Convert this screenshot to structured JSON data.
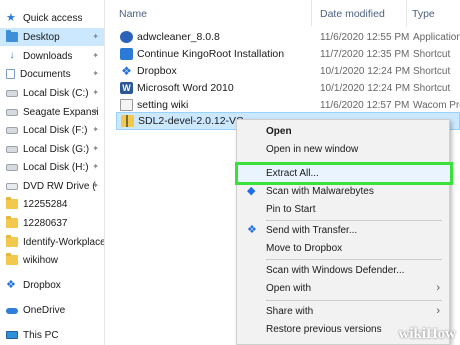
{
  "nav": {
    "items": [
      {
        "label": "Quick access",
        "icon": "star-icon"
      },
      {
        "label": "Desktop",
        "icon": "folder-icon",
        "pinned": true,
        "selected": true
      },
      {
        "label": "Downloads",
        "icon": "download-icon",
        "pinned": true
      },
      {
        "label": "Documents",
        "icon": "documents-icon",
        "pinned": true
      },
      {
        "label": "Local Disk (C:)",
        "icon": "drive-icon",
        "pinned": true
      },
      {
        "label": "Seagate Expansi",
        "icon": "drive-icon",
        "pinned": true
      },
      {
        "label": "Local Disk (F:)",
        "icon": "drive-icon",
        "pinned": true
      },
      {
        "label": "Local Disk (G:)",
        "icon": "drive-icon",
        "pinned": true
      },
      {
        "label": "Local Disk (H:)",
        "icon": "drive-icon",
        "pinned": true
      },
      {
        "label": "DVD RW Drive (",
        "icon": "dvd-icon",
        "pinned": true
      },
      {
        "label": "12255284",
        "icon": "folder-icon"
      },
      {
        "label": "12280637",
        "icon": "folder-icon"
      },
      {
        "label": "Identify-Workplace-",
        "icon": "folder-icon"
      },
      {
        "label": "wikihow",
        "icon": "folder-icon"
      },
      {
        "label": "Dropbox",
        "icon": "dropbox-icon"
      },
      {
        "label": "OneDrive",
        "icon": "onedrive-icon"
      },
      {
        "label": "This PC",
        "icon": "computer-icon"
      }
    ]
  },
  "header": {
    "name_label": "Name",
    "date_label": "Date modified",
    "type_label": "Type"
  },
  "files": [
    {
      "name": "adwcleaner_8.0.8",
      "date": "11/6/2020 12:55 PM",
      "type": "Application",
      "icon": "adwcleaner-icon"
    },
    {
      "name": "Continue KingoRoot Installation",
      "date": "11/7/2020 12:35 PM",
      "type": "Shortcut",
      "icon": "kingoroot-icon"
    },
    {
      "name": "Dropbox",
      "date": "10/1/2020 12:24 PM",
      "type": "Shortcut",
      "icon": "dropbox-icon"
    },
    {
      "name": "Microsoft Word 2010",
      "date": "10/1/2020 12:24 PM",
      "type": "Shortcut",
      "icon": "word-icon"
    },
    {
      "name": "setting wiki",
      "date": "11/6/2020 12:57 PM",
      "type": "Wacom Pre",
      "icon": "wiki-settings-icon"
    },
    {
      "name": "SDL2-devel-2.0.12-VC",
      "date": "",
      "type": "",
      "icon": "zip-folder-icon",
      "selected": true
    }
  ],
  "context_menu": {
    "items": [
      {
        "label": "Open",
        "bold": true
      },
      {
        "label": "Open in new window"
      },
      {
        "label": "Extract All...",
        "highlighted": true
      },
      {
        "label": "Scan with Malwarebytes",
        "icon": "malwarebytes-icon"
      },
      {
        "label": "Pin to Start"
      },
      {
        "label": "Send with Transfer...",
        "icon": "dropbox-icon"
      },
      {
        "label": "Move to Dropbox"
      },
      {
        "label": "Scan with Windows Defender..."
      },
      {
        "label": "Open with",
        "submenu": true
      },
      {
        "label": "Share with",
        "submenu": true
      },
      {
        "label": "Restore previous versions"
      }
    ],
    "highlight_color": "#3ae13a"
  },
  "watermark": {
    "part1": "wiki",
    "part2": "How"
  },
  "colors": {
    "selection": "#cce8ff",
    "accent": "#2d7ad6"
  }
}
